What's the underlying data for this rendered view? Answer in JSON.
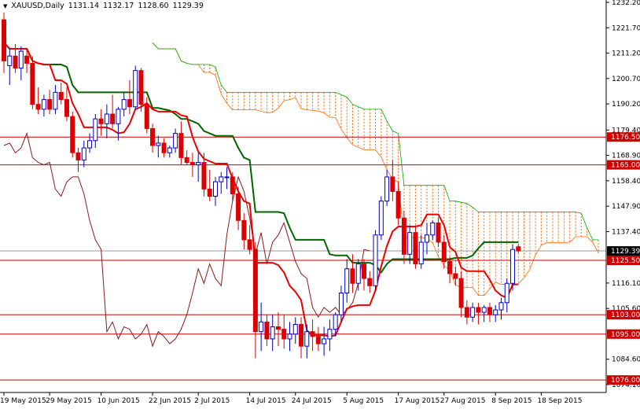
{
  "header": {
    "symbol": "XAUUSD,Daily",
    "open": "1131.14",
    "high": "1132.17",
    "low": "1128.60",
    "close": "1129.39",
    "dropdown_icon": "triangle-down-icon"
  },
  "colors": {
    "background": "#ffffff",
    "bull_candle": "#0000cc",
    "bear_candle": "#dd0000",
    "tenkan": "#ee0000",
    "kijun": "#006600",
    "chikou": "#8b1a1a",
    "kumo_bear": "#ff6600",
    "kumo_bull": "#00aa00",
    "support_resistance": "#cc0000",
    "price_label_bg": "#cc0000",
    "current_price_label_bg": "#000000",
    "current_price_line": "#999999"
  },
  "chart_data": {
    "type": "candlestick",
    "ylim": [
      1074.1,
      1232.2
    ],
    "y_ticks": [
      "1232.20",
      "1221.70",
      "1211.20",
      "1200.70",
      "1190.20",
      "1179.40",
      "1168.90",
      "1158.40",
      "1147.90",
      "1137.40",
      "1116.10",
      "1105.60",
      "1084.60",
      "1074.10"
    ],
    "x_ticks": [
      "19 May 2015",
      "29 May 2015",
      "10 Jun 2015",
      "22 Jun 2015",
      "2 Jul 2015",
      "14 Jul 2015",
      "24 Jul 2015",
      "5 Aug 2015",
      "17 Aug 2015",
      "27 Aug 2015",
      "8 Sep 2015",
      "18 Sep 2015"
    ],
    "x_tick_index": [
      0,
      8,
      17,
      26,
      34,
      43,
      51,
      60,
      69,
      77,
      86,
      94
    ],
    "horizontal_levels": [
      {
        "value": 1176.5,
        "label": "1176.50"
      },
      {
        "value": 1165.0,
        "label": "1165.00"
      },
      {
        "value": 1125.5,
        "label": "1125.50"
      },
      {
        "value": 1103.0,
        "label": "1103.00"
      },
      {
        "value": 1095.0,
        "label": "1095.00"
      },
      {
        "value": 1076.0,
        "label": "1076.00"
      }
    ],
    "current_price": {
      "value": 1129.39,
      "label": "1129.39"
    },
    "ohlc": [
      [
        1225,
        1228,
        1203,
        1208
      ],
      [
        1206,
        1213,
        1198,
        1210
      ],
      [
        1210,
        1215,
        1203,
        1205
      ],
      [
        1205,
        1214,
        1200,
        1212
      ],
      [
        1210,
        1213,
        1203,
        1207
      ],
      [
        1207,
        1210,
        1188,
        1190
      ],
      [
        1190,
        1197,
        1186,
        1188
      ],
      [
        1188,
        1194,
        1185,
        1192
      ],
      [
        1192,
        1196,
        1186,
        1188
      ],
      [
        1188,
        1198,
        1186,
        1195
      ],
      [
        1195,
        1199,
        1190,
        1192
      ],
      [
        1192,
        1197,
        1183,
        1185
      ],
      [
        1185,
        1187,
        1168,
        1170
      ],
      [
        1170,
        1172,
        1162,
        1167
      ],
      [
        1167,
        1175,
        1164,
        1172
      ],
      [
        1172,
        1178,
        1170,
        1175
      ],
      [
        1175,
        1186,
        1172,
        1184
      ],
      [
        1184,
        1188,
        1177,
        1182
      ],
      [
        1182,
        1190,
        1176,
        1186
      ],
      [
        1186,
        1194,
        1180,
        1182
      ],
      [
        1182,
        1189,
        1175,
        1188
      ],
      [
        1188,
        1195,
        1185,
        1192
      ],
      [
        1192,
        1200,
        1186,
        1189
      ],
      [
        1189,
        1206,
        1188,
        1204
      ],
      [
        1204,
        1205,
        1187,
        1190
      ],
      [
        1190,
        1193,
        1178,
        1180
      ],
      [
        1180,
        1182,
        1170,
        1173
      ],
      [
        1173,
        1177,
        1168,
        1174
      ],
      [
        1174,
        1176,
        1168,
        1170
      ],
      [
        1170,
        1173,
        1168,
        1172
      ],
      [
        1172,
        1180,
        1170,
        1178
      ],
      [
        1178,
        1183,
        1165,
        1168
      ],
      [
        1168,
        1171,
        1165,
        1166
      ],
      [
        1166,
        1170,
        1160,
        1165
      ],
      [
        1165,
        1170,
        1158,
        1166
      ],
      [
        1166,
        1170,
        1152,
        1155
      ],
      [
        1155,
        1163,
        1150,
        1152
      ],
      [
        1152,
        1160,
        1148,
        1158
      ],
      [
        1158,
        1162,
        1153,
        1160
      ],
      [
        1160,
        1164,
        1155,
        1160
      ],
      [
        1160,
        1162,
        1150,
        1153
      ],
      [
        1153,
        1156,
        1138,
        1142
      ],
      [
        1142,
        1145,
        1130,
        1134
      ],
      [
        1134,
        1140,
        1128,
        1130
      ],
      [
        1130,
        1133,
        1085,
        1096
      ],
      [
        1096,
        1108,
        1088,
        1100
      ],
      [
        1100,
        1103,
        1090,
        1093
      ],
      [
        1093,
        1103,
        1088,
        1098
      ],
      [
        1098,
        1104,
        1090,
        1097
      ],
      [
        1097,
        1103,
        1089,
        1093
      ],
      [
        1093,
        1100,
        1088,
        1095
      ],
      [
        1095,
        1102,
        1091,
        1099
      ],
      [
        1099,
        1102,
        1085,
        1090
      ],
      [
        1090,
        1099,
        1085,
        1096
      ],
      [
        1096,
        1101,
        1088,
        1094
      ],
      [
        1094,
        1098,
        1088,
        1091
      ],
      [
        1091,
        1098,
        1086,
        1093
      ],
      [
        1093,
        1101,
        1088,
        1097
      ],
      [
        1097,
        1104,
        1094,
        1103
      ],
      [
        1103,
        1115,
        1100,
        1112
      ],
      [
        1112,
        1126,
        1108,
        1122
      ],
      [
        1122,
        1128,
        1112,
        1116
      ],
      [
        1116,
        1126,
        1113,
        1124
      ],
      [
        1124,
        1126,
        1113,
        1118
      ],
      [
        1118,
        1121,
        1112,
        1115
      ],
      [
        1115,
        1138,
        1113,
        1136
      ],
      [
        1136,
        1152,
        1134,
        1150
      ],
      [
        1150,
        1163,
        1148,
        1160
      ],
      [
        1160,
        1167,
        1150,
        1154
      ],
      [
        1154,
        1158,
        1140,
        1143
      ],
      [
        1143,
        1146,
        1124,
        1128
      ],
      [
        1128,
        1140,
        1124,
        1137
      ],
      [
        1137,
        1140,
        1122,
        1124
      ],
      [
        1124,
        1136,
        1122,
        1133
      ],
      [
        1133,
        1141,
        1128,
        1136
      ],
      [
        1136,
        1142,
        1134,
        1141
      ],
      [
        1141,
        1143,
        1131,
        1133
      ],
      [
        1133,
        1136,
        1122,
        1125
      ],
      [
        1125,
        1127,
        1116,
        1120
      ],
      [
        1120,
        1123,
        1115,
        1118
      ],
      [
        1118,
        1121,
        1102,
        1106
      ],
      [
        1106,
        1109,
        1099,
        1102
      ],
      [
        1102,
        1108,
        1100,
        1106
      ],
      [
        1106,
        1108,
        1099,
        1104
      ],
      [
        1104,
        1107,
        1100,
        1106
      ],
      [
        1106,
        1108,
        1100,
        1103
      ],
      [
        1103,
        1107,
        1100,
        1105
      ],
      [
        1105,
        1110,
        1101,
        1108
      ],
      [
        1108,
        1118,
        1104,
        1116
      ],
      [
        1116,
        1132,
        1113,
        1130
      ],
      [
        1131.14,
        1132.17,
        1128.6,
        1129.39
      ]
    ]
  }
}
